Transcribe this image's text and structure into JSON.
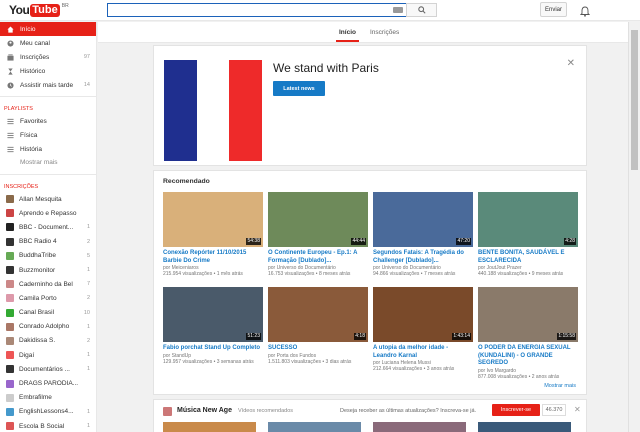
{
  "header": {
    "logo_you": "You",
    "logo_tube": "Tube",
    "logo_region": "BR",
    "upload_label": "Enviar"
  },
  "tabs": [
    {
      "label": "Início"
    },
    {
      "label": "Inscrições"
    }
  ],
  "sidebar": {
    "nav": [
      {
        "label": "Início",
        "count": ""
      },
      {
        "label": "Meu canal",
        "count": ""
      },
      {
        "label": "Inscrições",
        "count": "97"
      },
      {
        "label": "Histórico",
        "count": ""
      },
      {
        "label": "Assistir mais tarde",
        "count": "14"
      }
    ],
    "playlists_heading": "PLAYLISTS",
    "playlists": [
      {
        "label": "Favorites"
      },
      {
        "label": "Física"
      },
      {
        "label": "História"
      }
    ],
    "more_label": "Mostrar mais",
    "subs_heading": "INSCRIÇÕES",
    "subs": [
      {
        "label": "Allan Mesquita",
        "count": "",
        "color": "#8a6a4a"
      },
      {
        "label": "Aprendo e Repasso",
        "count": "",
        "color": "#c44"
      },
      {
        "label": "BBC - Document...",
        "count": "1",
        "color": "#222"
      },
      {
        "label": "BBC Radio 4",
        "count": "2",
        "color": "#333"
      },
      {
        "label": "BuddhaTribe",
        "count": "5",
        "color": "#6a5"
      },
      {
        "label": "Buzzmonitor",
        "count": "1",
        "color": "#333"
      },
      {
        "label": "Caderninho da Bel",
        "count": "7",
        "color": "#c88"
      },
      {
        "label": "Camila Porto",
        "count": "2",
        "color": "#d9a"
      },
      {
        "label": "Canal Brasil",
        "count": "10",
        "color": "#3a3"
      },
      {
        "label": "Conrado Adolpho",
        "count": "1",
        "color": "#a76"
      },
      {
        "label": "Dakidissa S.",
        "count": "2",
        "color": "#a87"
      },
      {
        "label": "Digaí",
        "count": "1",
        "color": "#e55"
      },
      {
        "label": "Documentários ...",
        "count": "1",
        "color": "#333"
      },
      {
        "label": "DRAGS PARODIA...",
        "count": "",
        "color": "#96c"
      },
      {
        "label": "Embrafilme",
        "count": "",
        "color": "#ccc"
      },
      {
        "label": "EnglishLessons4...",
        "count": "1",
        "color": "#49c"
      },
      {
        "label": "Escola B Social",
        "count": "1",
        "color": "#d55"
      }
    ]
  },
  "banner": {
    "title": "We stand with Paris",
    "button": "Latest news",
    "flag_colors": [
      "#1f2f8f",
      "#ffffff",
      "#ee2a2a"
    ]
  },
  "recommended": {
    "heading": "Recomendado",
    "more": "Mostrar mais",
    "videos": [
      {
        "title": "Conexão Repórter 11/10/2015 Barbie Do Crime",
        "channel": "por Meiceniaros",
        "views": "215.954 visualizações",
        "age": "1 mês atrás",
        "duration": "54:38",
        "thumb": "#d9b07a"
      },
      {
        "title": "O Continente Europeu - Ep.1: A Formação [Dublado]...",
        "channel": "por Universo do Documentário",
        "views": "16.753 visualizações",
        "age": "8 meses atrás",
        "duration": "44:44",
        "thumb": "#6e8a5a"
      },
      {
        "title": "Segundos Fatais: A Tragédia do Challenger [Dublado]...",
        "channel": "por Universo do Documentário",
        "views": "94.866 visualizações",
        "age": "7 meses atrás",
        "duration": "47:20",
        "thumb": "#4a6a9a"
      },
      {
        "title": "BENTE BONITA, SAUDÁVEL E ESCLARECIDA",
        "channel": "por JoutJout Prazer",
        "views": "440.188 visualizações",
        "age": "9 meses atrás",
        "duration": "4:28",
        "thumb": "#5a8a7a"
      },
      {
        "title": "Fabio porchat Stand Up Completo",
        "channel": "por StandUp",
        "views": "129.957 visualizações",
        "age": "3 semanas atrás",
        "duration": "51:23",
        "thumb": "#4a5a6a"
      },
      {
        "title": "SUCESSO",
        "channel": "por Porta dos Fundos",
        "views": "1.511.803 visualizações",
        "age": "3 dias atrás",
        "duration": "4:18",
        "thumb": "#8a5a3a"
      },
      {
        "title": "A utopia da melhor idade - Leandro Karnal",
        "channel": "por Luciana Helena Mussi",
        "views": "212.664 visualizações",
        "age": "3 anos atrás",
        "duration": "1:43:14",
        "thumb": "#7a4a2a"
      },
      {
        "title": "O PODER DA ENERGIA SEXUAL (KUNDALINI) - O GRANDE SEGREDO",
        "channel": "por Ivo Margardo",
        "views": "877.008 visualizações",
        "age": "2 anos atrás",
        "duration": "1:15:58",
        "thumb": "#8a7a6a"
      }
    ]
  },
  "music": {
    "title": "Música New Age",
    "subtitle": "Vídeos recomendados",
    "question": "Deseja receber as últimas atualizações? Inscreva-se já.",
    "subscribe": "Inscrever-se",
    "subcount": "46.370"
  }
}
